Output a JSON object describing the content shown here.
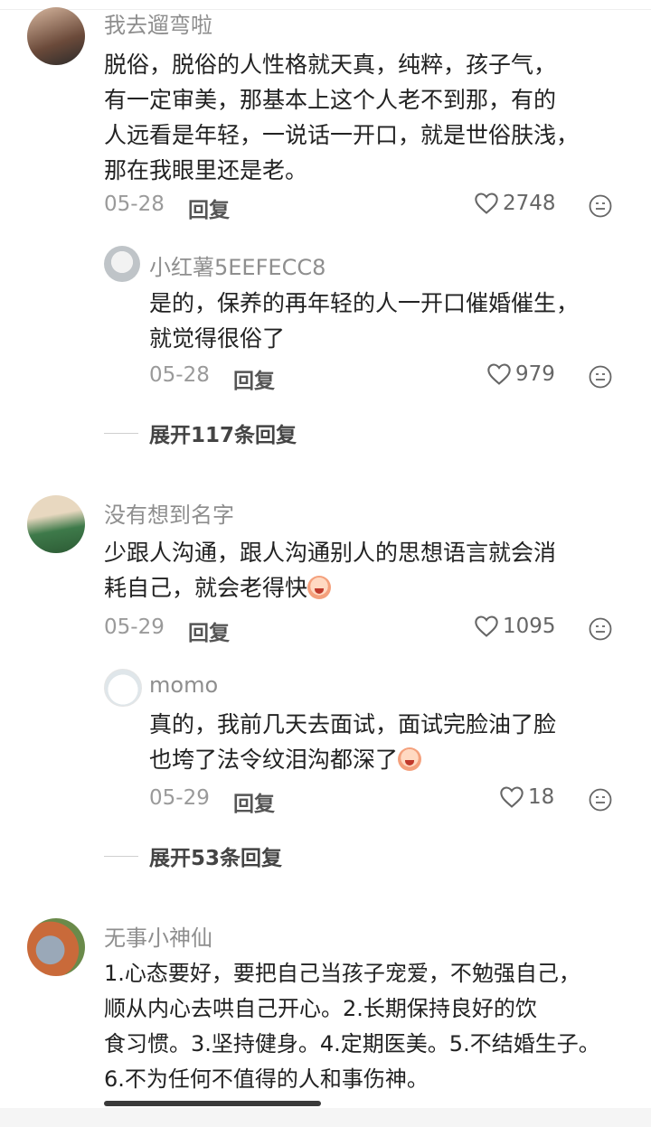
{
  "comments": [
    {
      "name": "我去遛弯啦",
      "text_lines": [
        "脱俗，脱俗的人性格就天真，纯粹，孩子气，",
        "有一定审美，那基本上这个人老不到那，有的",
        "人远看是年轻，一说话一开口，就是世俗肤浅，",
        "那在我眼里还是老。"
      ],
      "date": "05-28",
      "reply_label": "回复",
      "likes": "2748",
      "avatar_color": "#6b4a3a"
    },
    {
      "name": "没有想到名字",
      "text_lines": [
        "少跟人沟通，跟人沟通别人的思想语言就会消",
        "耗自己，就会老得快"
      ],
      "date": "05-29",
      "reply_label": "回复",
      "likes": "1095",
      "avatar_color": "#3e7a4a"
    },
    {
      "name": "无事小神仙",
      "text_lines": [
        "1.心态要好，要把自己当孩子宠爱，不勉强自己，",
        "顺从内心去哄自己开心。2.长期保持良好的饮",
        "食习惯。3.坚持健身。4.定期医美。5.不结婚生子。",
        "6.不为任何不值得的人和事伤神。"
      ],
      "avatar_color": "#c96a3a"
    }
  ],
  "replies": [
    {
      "name": "小红薯5EEFECC8",
      "text_lines": [
        "是的，保养的再年轻的人一开口催婚催生，",
        "就觉得很俗了"
      ],
      "date": "05-28",
      "reply_label": "回复",
      "likes": "979"
    },
    {
      "name": "momo",
      "text_lines": [
        "真的，我前几天去面试，面试完脸油了脸",
        "也垮了法令纹泪沟都深了"
      ],
      "date": "05-29",
      "reply_label": "回复",
      "likes": "18"
    }
  ],
  "expand": [
    {
      "label": "展开117条回复"
    },
    {
      "label": "展开53条回复"
    }
  ],
  "colors": {
    "name": "#8e8e8e",
    "text": "#222222",
    "meta": "#9a9a9a"
  }
}
